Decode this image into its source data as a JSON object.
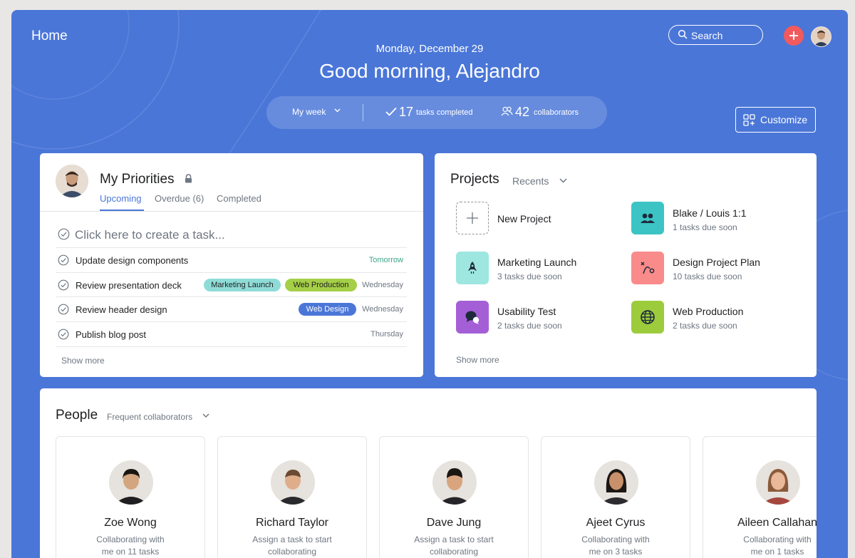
{
  "header": {
    "title": "Home",
    "search_label": "Search",
    "date": "Monday, December 29",
    "greeting": "Good morning, Alejandro",
    "week_label": "My week",
    "tasks_completed_count": "17",
    "tasks_completed_label": "tasks completed",
    "collaborators_count": "42",
    "collaborators_label": "collaborators",
    "customize_label": "Customize",
    "accent_color": "#4a76d8",
    "add_color": "#f25a5d"
  },
  "priorities": {
    "title": "My Priorities",
    "tabs": [
      {
        "label": "Upcoming",
        "active": true
      },
      {
        "label": "Overdue (6)",
        "active": false
      },
      {
        "label": "Completed",
        "active": false
      }
    ],
    "create_placeholder": "Click here to create a task...",
    "tasks": [
      {
        "name": "Update design components",
        "due": "Tomorrow",
        "tags": []
      },
      {
        "name": "Review presentation deck",
        "due": "Wednesday",
        "tags": [
          "Marketing Launch",
          "Web Production"
        ]
      },
      {
        "name": "Review header design",
        "due": "Wednesday",
        "tags": [
          "Web Design"
        ]
      },
      {
        "name": "Publish blog post",
        "due": "Thursday",
        "tags": []
      }
    ],
    "show_more": "Show more"
  },
  "projects": {
    "title": "Projects",
    "filter": "Recents",
    "new_project": "New Project",
    "items": [
      {
        "name": "Blake / Louis 1:1",
        "sub": "1 tasks due soon",
        "color": "#3cc4c4",
        "icon": "people-icon"
      },
      {
        "name": "Marketing Launch",
        "sub": "3 tasks due soon",
        "color": "#9ee6e0",
        "icon": "rocket-icon"
      },
      {
        "name": "Design Project Plan",
        "sub": "10 tasks due soon",
        "color": "#f98b8b",
        "icon": "path-icon"
      },
      {
        "name": "Usability Test",
        "sub": "2 tasks due soon",
        "color": "#a55fd6",
        "icon": "chat-icon"
      },
      {
        "name": "Web Production",
        "sub": "2 tasks due soon",
        "color": "#9ccc3c",
        "icon": "globe-icon"
      }
    ],
    "show_more": "Show more"
  },
  "people": {
    "title": "People",
    "filter": "Frequent collaborators",
    "items": [
      {
        "name": "Zoe Wong",
        "line1": "Collaborating with",
        "line2": "me on 11 tasks"
      },
      {
        "name": "Richard Taylor",
        "line1": "Assign a task to start",
        "line2": "collaborating"
      },
      {
        "name": "Dave Jung",
        "line1": "Assign a task to start",
        "line2": "collaborating"
      },
      {
        "name": "Ajeet Cyrus",
        "line1": "Collaborating with",
        "line2": "me on 3 tasks"
      },
      {
        "name": "Aileen Callahan",
        "line1": "Collaborating with",
        "line2": "me on 1 tasks"
      }
    ]
  }
}
